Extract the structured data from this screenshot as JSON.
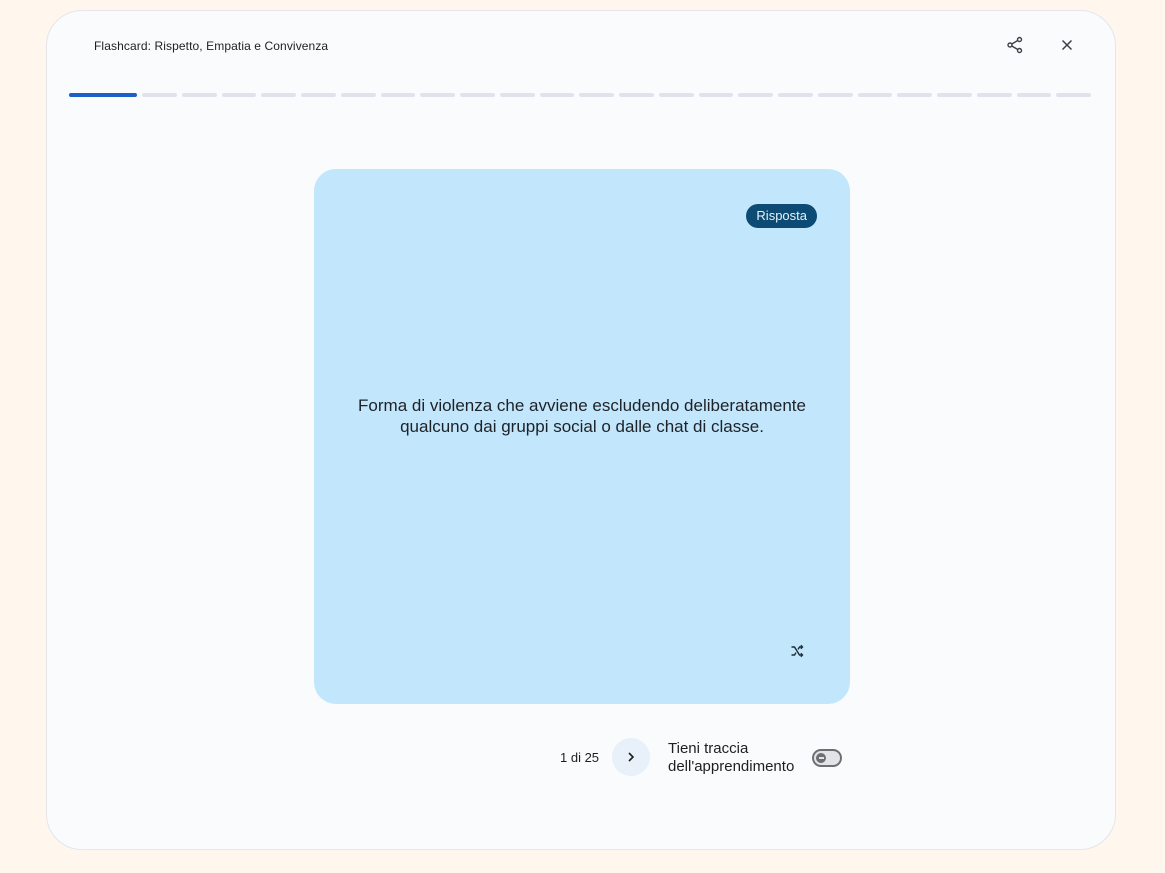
{
  "header": {
    "title": "Flashcard: Rispetto, Empatia e Convivenza",
    "share_icon": "share-icon",
    "close_icon": "close-icon"
  },
  "progress": {
    "current": 1,
    "total": 25
  },
  "card": {
    "badge": "Risposta",
    "text": "Forma di violenza che avviene escludendo deliberatamente qualcuno dai gruppi social o dalle chat di classe.",
    "shuffle_icon": "shuffle-icon"
  },
  "footer": {
    "counter": "1 di 25",
    "next_icon": "chevron-right-icon",
    "track_label": "Tieni traccia dell'apprendimento",
    "track_enabled": false
  },
  "colors": {
    "card_background": "#c2e6fc",
    "badge_background": "#0c4b73",
    "progress_active": "#1b5fc7",
    "progress_inactive": "#dfe4ec"
  }
}
